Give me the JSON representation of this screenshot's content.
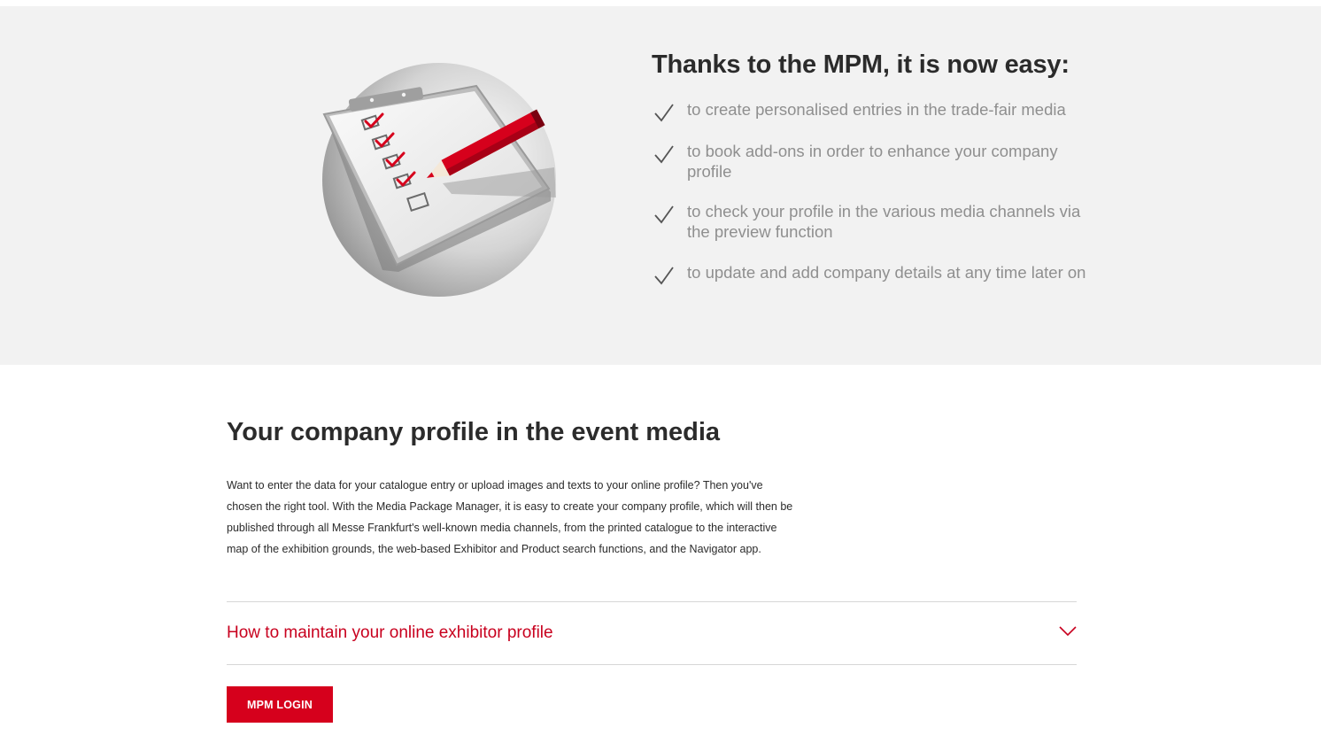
{
  "hero": {
    "title": "Thanks to the MPM, it is now easy:",
    "benefits": [
      "to create personalised entries in the trade-fair media",
      "to book add-ons in order to enhance your company profile",
      "to check your profile in the various media channels via the preview function",
      "to update and add company details at any time later on"
    ]
  },
  "profile": {
    "title": "Your company profile in the event media",
    "intro": "Want to enter the data for your catalogue entry or upload images and texts to your online profile? Then you've chosen the right tool. With the Media Package Manager, it is easy to create your company profile, which will then be published through all Messe Frankfurt's well-known media channels, from the printed catalogue to the interactive map of the exhibition grounds, the web-based Exhibitor and Product search functions, and the Navigator app."
  },
  "accordion": {
    "label": "How to maintain your online exhibitor profile",
    "icon": "chevron-down-icon"
  },
  "login_button": {
    "label": "MPM LOGIN"
  },
  "colors": {
    "accent": "#d6001c",
    "link": "#c8001e",
    "hero_bg": "#f2f2f2",
    "muted_text": "#8f8f8f"
  }
}
